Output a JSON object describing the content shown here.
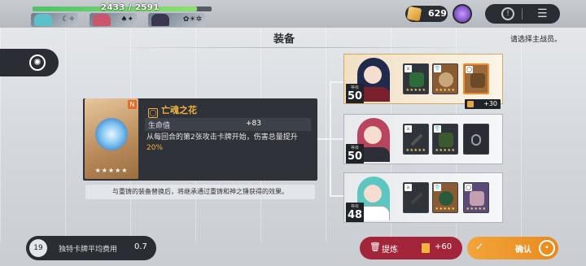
{
  "top": {
    "hp_text": "2433 / 2591",
    "hp_fraction": 0.92,
    "gold": "629"
  },
  "title": "装备",
  "hint": "请选择主战员。",
  "item": {
    "name": "亡魂之花",
    "rarity_tag": "N",
    "stars": "★★★★★",
    "stat_key": "生命值",
    "stat_value": "+83",
    "desc_pre": "从每回合的第2张攻击卡牌开始，伤害总量提升",
    "desc_hl": "20%",
    "desc_post": ""
  },
  "note": "与重铸的装备替换后，将继承通过重铸和神之锤获得的效果。",
  "characters": [
    {
      "level": "50",
      "level_label": "等级",
      "bonus": "+30"
    },
    {
      "level": "50",
      "level_label": "等级"
    },
    {
      "level": "48",
      "level_label": "等级"
    }
  ],
  "bottom": {
    "cost_icon": "19",
    "cost_label": "独特卡牌平均费用",
    "cost_value": "0.7",
    "refine_label": "提炼",
    "refine_value": "+60",
    "confirm_label": "确认"
  },
  "colors": {
    "accent": "#f08a2e",
    "refine": "#a3253a",
    "highlight": "#f3b33e"
  }
}
